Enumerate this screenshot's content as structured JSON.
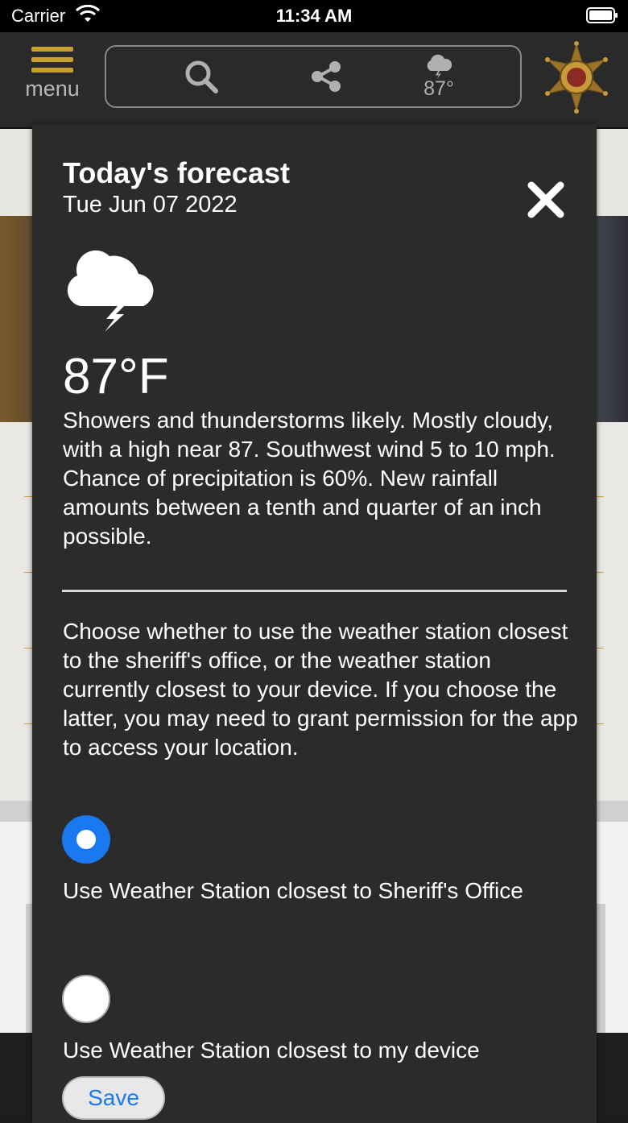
{
  "status_bar": {
    "carrier": "Carrier",
    "time": "11:34 AM"
  },
  "header": {
    "menu_label": "menu",
    "weather_temp": "87°",
    "icons": [
      "menu-icon",
      "search-icon",
      "share-icon",
      "storm-cloud-icon",
      "sheriff-badge-icon"
    ]
  },
  "forecast_modal": {
    "title": "Today's forecast",
    "date": "Tue Jun 07 2022",
    "weather_icon": "thunderstorm-cloud-icon",
    "temperature": "87°F",
    "description": "Showers and thunderstorms likely. Mostly cloudy, with a high near 87. Southwest wind 5 to 10 mph. Chance of precipitation is 60%. New rainfall amounts between a tenth and quarter of an inch possible.",
    "choose_text": "Choose whether to use the weather station closest to the sheriff's office, or the weather station currently closest to your device. If you choose the latter, you may need to grant permission for the app to access your location.",
    "options": [
      {
        "label": "Use Weather Station closest to Sheriff's Office",
        "selected": true
      },
      {
        "label": "Use Weather Station closest to my device",
        "selected": false
      }
    ],
    "save_label": "Save"
  },
  "colors": {
    "accent_gold": "#c8a030",
    "radio_selected": "#1a78f0",
    "modal_bg": "#2b2b2b"
  }
}
